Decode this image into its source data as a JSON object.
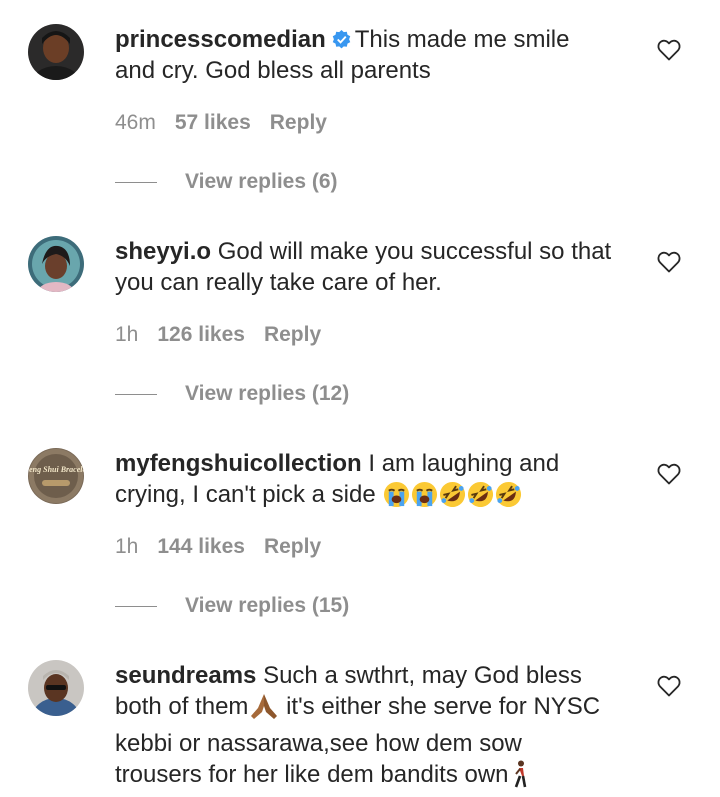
{
  "comments": [
    {
      "username": "princesscomedian",
      "verified": true,
      "text": "This made me smile and cry. God bless all parents",
      "time": "46m",
      "likes": "57 likes",
      "reply": "Reply",
      "view_replies": "View replies (6)"
    },
    {
      "username": "sheyyi.o",
      "text": "God will make you successful so that you can really take care of her.",
      "time": "1h",
      "likes": "126 likes",
      "reply": "Reply",
      "view_replies": "View replies (12)"
    },
    {
      "username": "myfengshuicollection",
      "text": "I am laughing and crying, I can't pick a side",
      "emojis": [
        "loudly-crying-face",
        "loudly-crying-face",
        "rolling-on-floor-laughing",
        "rolling-on-floor-laughing",
        "rolling-on-floor-laughing"
      ],
      "avatar_text": "Feng Shui Bracelet",
      "time": "1h",
      "likes": "144 likes",
      "reply": "Reply",
      "view_replies": "View replies (15)"
    },
    {
      "username": "seundreams",
      "text_part1": "Such a swthrt, may God bless both of them",
      "text_part2": "it's either she serve for NYSC kebbi or nassarawa,see how dem sow trousers for her like dem bandits own",
      "emojis": [
        "folded-hands",
        "person-walking"
      ]
    }
  ],
  "colors": {
    "text": "#262626",
    "secondary": "#8e8e8e",
    "verified": "#3897f0"
  }
}
